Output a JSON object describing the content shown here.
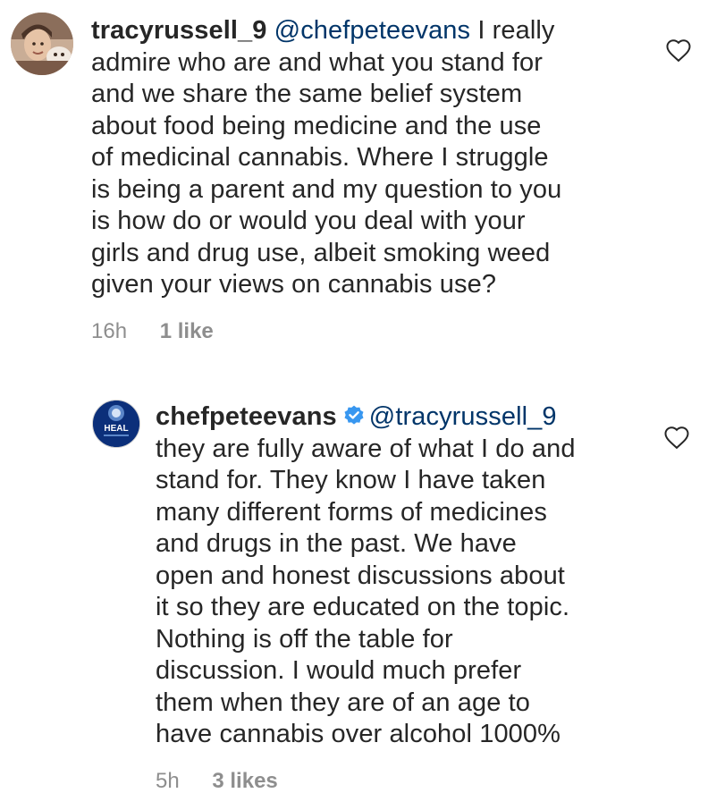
{
  "comments": [
    {
      "username": "tracyrussell_9",
      "mention": "@chefpeteevans",
      "first_line_rest": "I really",
      "lines": [
        "admire who are and what you stand for",
        "and we share the same belief system",
        "about food being medicine and the use",
        "of medicinal cannabis. Where I struggle",
        "is being a parent and my question to you",
        "is how do or would you deal with your",
        "girls and drug use, albeit smoking weed",
        "given your views on cannabis use?"
      ],
      "time": "16h",
      "likes": "1 like"
    },
    {
      "username": "chefpeteevans",
      "mention": "@tracyrussell_9",
      "avatar_text": "HEAL",
      "lines": [
        "they are fully aware of what I do and",
        "stand for.  They know I have taken",
        "many different forms of medicines",
        "and drugs in the past.  We have",
        "open and honest discussions about",
        "it so they are educated on the topic.",
        "Nothing is off the table for",
        "discussion.  I would much prefer",
        "them when they are of an age to",
        "have cannabis over alcohol 1000%"
      ],
      "time": "5h",
      "likes": "3 likes"
    }
  ],
  "icons": {
    "heart": "heart-outline-icon",
    "verified": "verified-badge-icon"
  },
  "colors": {
    "text": "#262626",
    "mention": "#003569",
    "meta": "#8e8e8e",
    "verified": "#3897f0",
    "heal_avatar": "#0b2f7a"
  }
}
